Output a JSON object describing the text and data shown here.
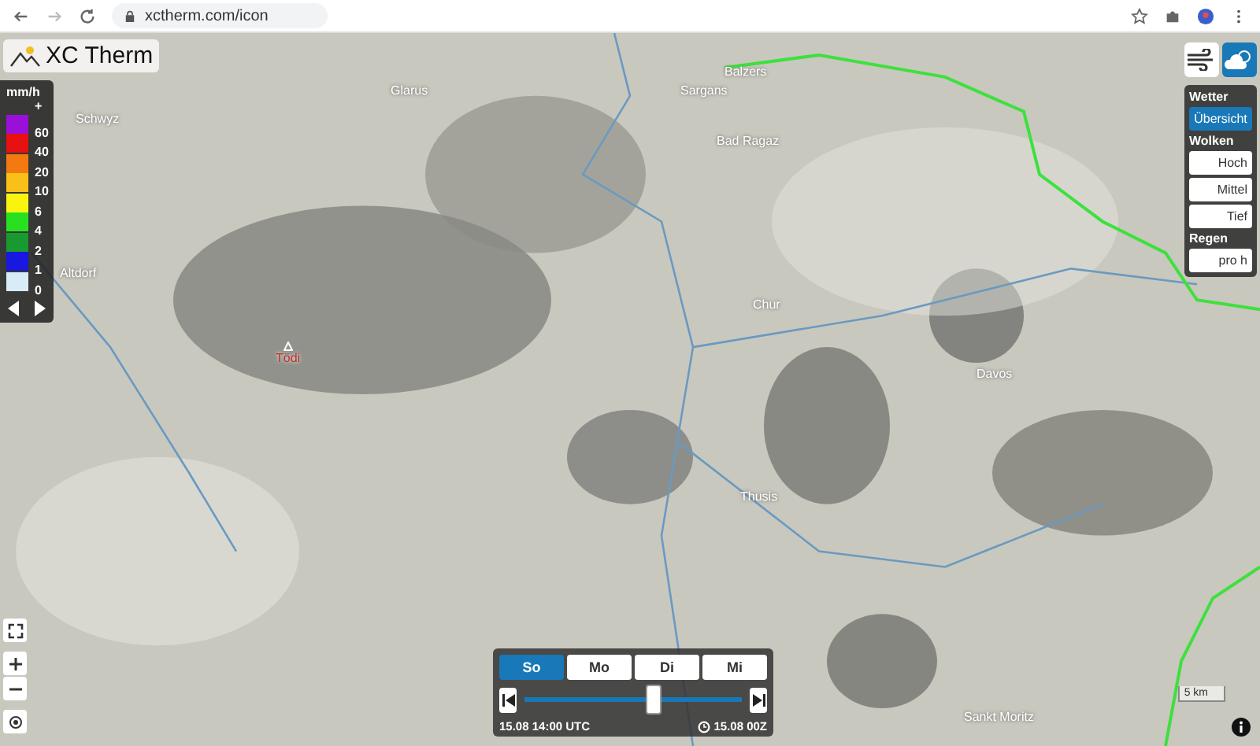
{
  "browser": {
    "url": "xctherm.com/icon"
  },
  "app": {
    "title": "XC Therm"
  },
  "legend": {
    "unit": "mm/h",
    "top_label": "+",
    "items": [
      {
        "color": "#9b10d8",
        "label": "60"
      },
      {
        "color": "#e81010",
        "label": "40"
      },
      {
        "color": "#f27a10",
        "label": "20"
      },
      {
        "color": "#f8c018",
        "label": "10"
      },
      {
        "color": "#f8f410",
        "label": "6"
      },
      {
        "color": "#28e020",
        "label": "4"
      },
      {
        "color": "#189a30",
        "label": "2"
      },
      {
        "color": "#1818e0",
        "label": "1"
      },
      {
        "color": "#d8ecf8",
        "label": "0"
      }
    ]
  },
  "layer_buttons": [
    {
      "kind": "wind",
      "selected": false
    },
    {
      "kind": "weather",
      "selected": true
    }
  ],
  "panel": [
    {
      "heading": "Wetter",
      "items": [
        {
          "label": "Übersicht",
          "selected": true
        }
      ]
    },
    {
      "heading": "Wolken",
      "items": [
        {
          "label": "Hoch",
          "selected": false
        },
        {
          "label": "Mittel",
          "selected": false
        },
        {
          "label": "Tief",
          "selected": false
        }
      ]
    },
    {
      "heading": "Regen",
      "items": [
        {
          "label": "pro h",
          "selected": false
        }
      ]
    }
  ],
  "places": [
    {
      "name": "Schwyz",
      "kind": "town"
    },
    {
      "name": "Glarus",
      "kind": "town"
    },
    {
      "name": "Altdorf",
      "kind": "town"
    },
    {
      "name": "Sargans",
      "kind": "town"
    },
    {
      "name": "Balzers",
      "kind": "town"
    },
    {
      "name": "Bad Ragaz",
      "kind": "town"
    },
    {
      "name": "Chur",
      "kind": "town"
    },
    {
      "name": "Tödi",
      "kind": "peak"
    },
    {
      "name": "Davos",
      "kind": "town"
    },
    {
      "name": "Thusis",
      "kind": "town"
    },
    {
      "name": "Sankt Moritz",
      "kind": "town"
    }
  ],
  "scale": "5 km",
  "timeline": {
    "days": [
      {
        "label": "So",
        "selected": true
      },
      {
        "label": "Mo",
        "selected": false
      },
      {
        "label": "Di",
        "selected": false
      },
      {
        "label": "Mi",
        "selected": false
      }
    ],
    "level": 0.6,
    "time": "15.08 14:00 UTC",
    "run": "15.08 00Z"
  }
}
